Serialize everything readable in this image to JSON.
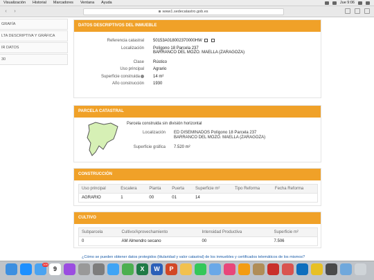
{
  "menubar": {
    "items": [
      "Visualización",
      "Historial",
      "Marcadores",
      "Ventana",
      "Ayuda"
    ],
    "clock": "Jue 9:06"
  },
  "browser": {
    "url": "www1.sedecatastro.gob.es",
    "icons": {
      "back": "chevron-left-icon",
      "forward": "chevron-right-icon",
      "sidebar": "sidebar-icon",
      "share": "share-icon",
      "tabs": "tabs-icon",
      "new_tab": "plus-icon"
    }
  },
  "leftnav": {
    "items": [
      "GRAFÍA",
      "LTA DESCRIPTIVA Y GRÁFICA",
      "IR DATOS",
      "30"
    ]
  },
  "descriptivos": {
    "title": "DATOS DESCRIPTIVOS DEL INMUEBLE",
    "rows": [
      {
        "label": "Referencia catastral",
        "value": "50153A018002370000HW"
      },
      {
        "label": "Localización",
        "value": "Polígono 18 Parcela 237"
      },
      {
        "label": "",
        "value": "BARRANCO DEL MOZO. MAELLA (ZARAGOZA)"
      },
      {
        "label": "Clase",
        "value": "Rústico"
      },
      {
        "label": "Uso principal",
        "value": "Agrario"
      },
      {
        "label": "Superficie construida",
        "value": "14 m²"
      },
      {
        "label": "Año construcción",
        "value": "1930"
      }
    ]
  },
  "parcela": {
    "title": "PARCELA CATASTRAL",
    "subtitle": "Parcela construida sin división horizontal",
    "loc_label": "Localización",
    "loc_line1": "ED DISEMINADOS Polígono 18 Parcela 237",
    "loc_line2": "BARRANCO DEL MOZO. MAELLA (ZARAGOZA)",
    "sup_label": "Superficie gráfica",
    "sup_value": "7.520 m²",
    "map_fill": "#d6f0b5",
    "map_stroke": "#555555"
  },
  "construccion": {
    "title": "CONSTRUCCIÓN",
    "headers": [
      "Uso principal",
      "Escalera",
      "Planta",
      "Puerta",
      "Superficie m²",
      "Tipo Reforma",
      "Fecha Reforma"
    ],
    "rows": [
      [
        "AGRARIO",
        "1",
        "00",
        "01",
        "14",
        "",
        ""
      ]
    ]
  },
  "cultivo": {
    "title": "CULTIVO",
    "headers": [
      "Subparcela",
      "Cultivo/Aprovechamiento",
      "Intensidad Productiva",
      "Superficie m²"
    ],
    "rows": [
      [
        "0",
        "AM Almendro secano",
        "00",
        "7.506"
      ]
    ]
  },
  "footer_link": "¿Cómo se pueden obtener datos protegidos (titularidad y valor catastral) de los inmuebles y certificados telemáticos de los mismos?",
  "colors": {
    "accent": "#f0a128",
    "link": "#1a5ca8"
  },
  "dock": {
    "apps": [
      {
        "name": "finder-icon",
        "color": "#3d8fe0"
      },
      {
        "name": "app-store-icon",
        "color": "#1e90ff"
      },
      {
        "name": "mail-icon",
        "color": "#4aa3f0",
        "badge": "105"
      },
      {
        "name": "calendar-icon",
        "color": "#ffffff",
        "glyph": "9"
      },
      {
        "name": "podcasts-icon",
        "color": "#9b4de0"
      },
      {
        "name": "launchpad-icon",
        "color": "#999999"
      },
      {
        "name": "system-preferences-icon",
        "color": "#7d7d7d"
      },
      {
        "name": "safari-icon",
        "color": "#3fa4f5"
      },
      {
        "name": "maps-icon",
        "color": "#4caf50"
      },
      {
        "name": "excel-icon",
        "color": "#1e7a45",
        "glyph": "X"
      },
      {
        "name": "word-icon",
        "color": "#2b5fb8",
        "glyph": "W"
      },
      {
        "name": "powerpoint-icon",
        "color": "#d24726",
        "glyph": "P"
      },
      {
        "name": "photos-icon",
        "color": "#f2c14e"
      },
      {
        "name": "messages-icon",
        "color": "#34c759"
      },
      {
        "name": "preview-icon",
        "color": "#6aa8e8"
      },
      {
        "name": "itunes-icon",
        "color": "#e8467a"
      },
      {
        "name": "ibooks-icon",
        "color": "#f39c12"
      },
      {
        "name": "contacts-icon",
        "color": "#b08d57"
      },
      {
        "name": "acrobat-icon",
        "color": "#c9302c"
      },
      {
        "name": "pdf-icon",
        "color": "#d9534f"
      },
      {
        "name": "teamviewer-icon",
        "color": "#0e6ebd"
      },
      {
        "name": "chrome-icon",
        "color": "#e7c025"
      },
      {
        "name": "quicktime-icon",
        "color": "#4a4a4a"
      },
      {
        "name": "folder-icon",
        "color": "#6fa8dc"
      },
      {
        "name": "trash-icon",
        "color": "#cfd4d8"
      }
    ]
  }
}
